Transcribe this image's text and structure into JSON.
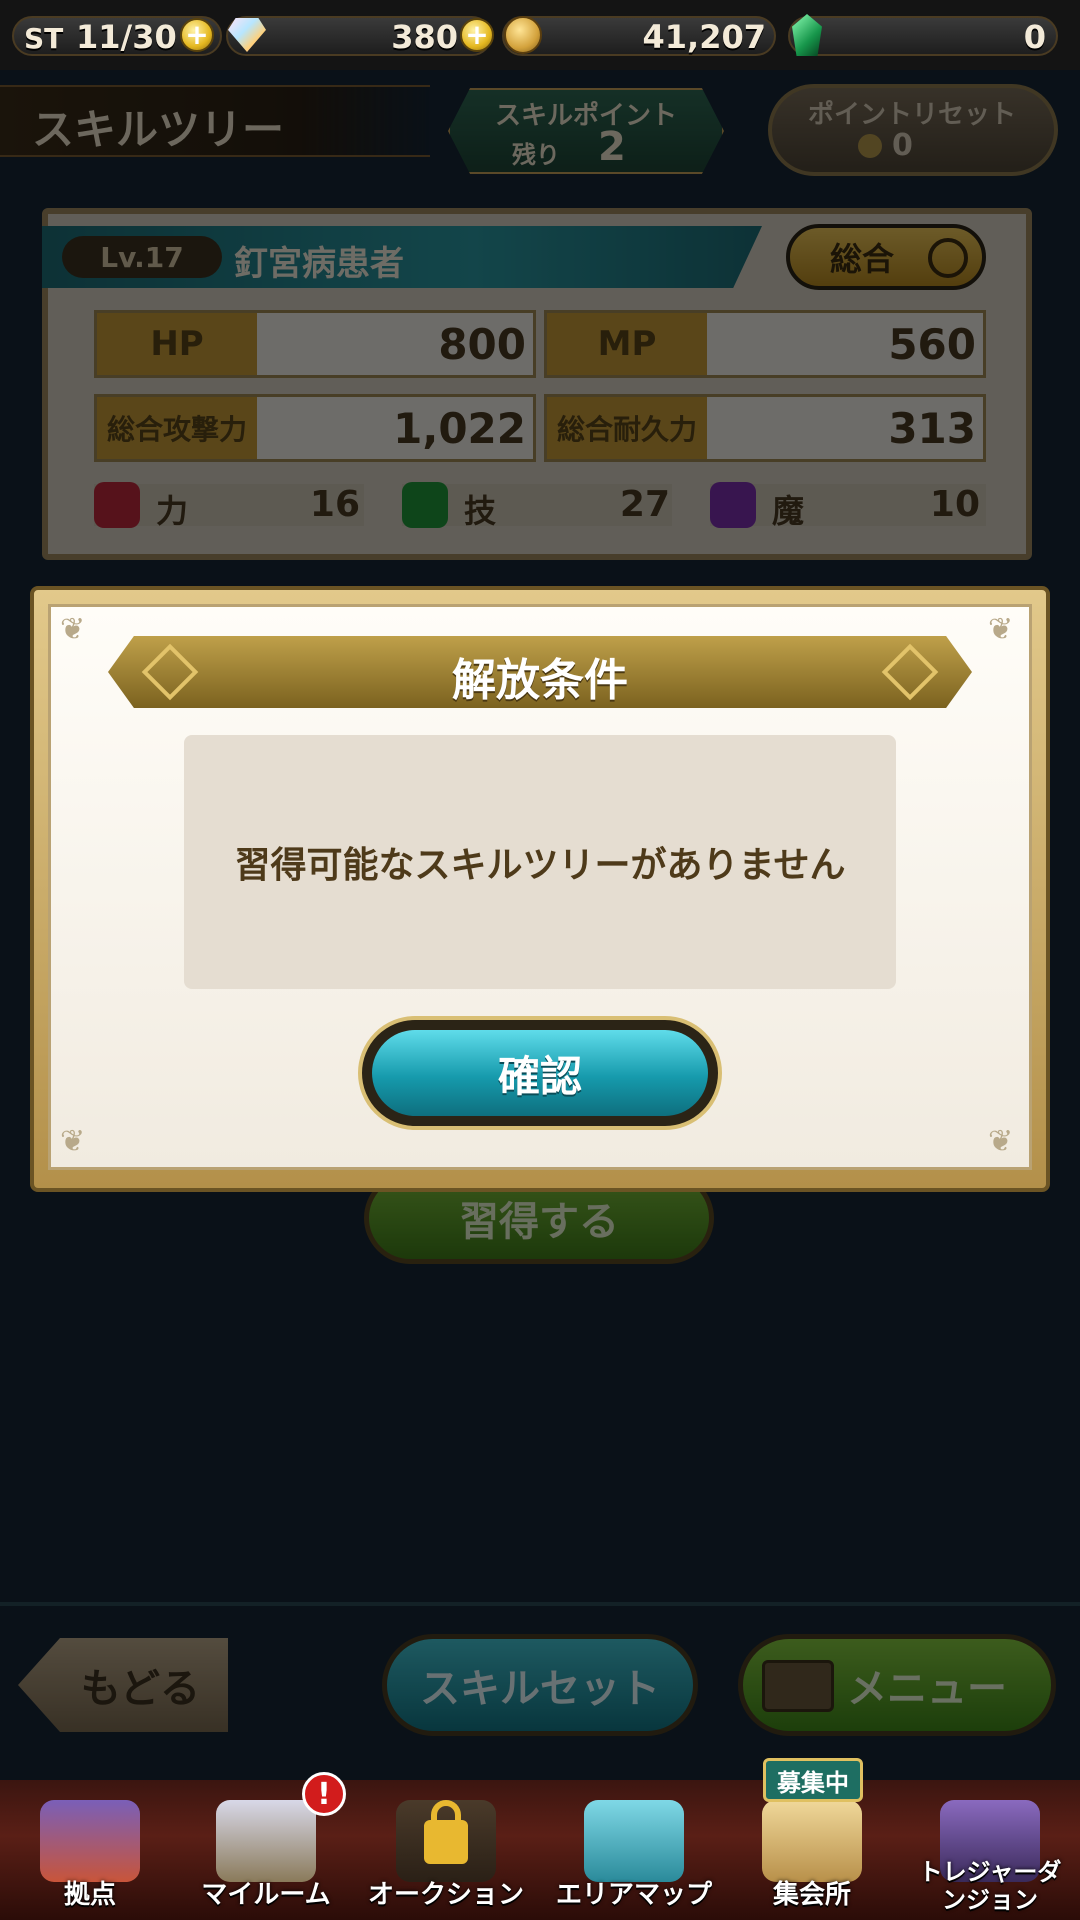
{
  "topbar": {
    "stamina_label": "ST",
    "stamina_value": "11/30",
    "gems_value": "380",
    "gold_value": "41,207",
    "green_gem_value": "0",
    "plus_symbol": "+"
  },
  "header": {
    "title": "スキルツリー",
    "skill_points_label": "スキルポイント",
    "skill_points_remaining_label": "残り",
    "skill_points_remaining_value": "2",
    "reset_label": "ポイントリセット",
    "reset_cost": "0"
  },
  "character": {
    "level": "Lv.17",
    "name": "釘宮病患者",
    "view_mode": "総合",
    "stats": [
      {
        "label": "HP",
        "value": "800"
      },
      {
        "label": "MP",
        "value": "560"
      },
      {
        "label": "総合攻撃力",
        "value": "1,022"
      },
      {
        "label": "総合耐久力",
        "value": "313"
      }
    ],
    "attributes": [
      {
        "label": "力",
        "value": "16",
        "icon": "fist-icon",
        "color": "#c0283c"
      },
      {
        "label": "技",
        "value": "27",
        "icon": "star-icon",
        "color": "#1f9a3a"
      },
      {
        "label": "魔",
        "value": "10",
        "icon": "magic-icon",
        "color": "#7c2fb0"
      }
    ]
  },
  "actions": {
    "learn_label": "習得する",
    "back_label": "もどる",
    "skillset_label": "スキルセット",
    "menu_label": "メニュー"
  },
  "modal": {
    "title": "解放条件",
    "message": "習得可能なスキルツリーがありません",
    "confirm_label": "確認"
  },
  "bottom_nav": {
    "items": [
      {
        "label": "拠点",
        "icon": "base-tent-icon"
      },
      {
        "label": "マイルーム",
        "icon": "sword-shield-icon"
      },
      {
        "label": "オークション",
        "icon": "locked-auction-icon"
      },
      {
        "label": "エリアマップ",
        "icon": "map-icon"
      },
      {
        "label": "集会所",
        "icon": "guild-hall-icon"
      },
      {
        "label": "トレジャーダンジョン",
        "icon": "treasure-dungeon-icon"
      }
    ],
    "alert_symbol": "!",
    "recruit_badge": "募集中"
  },
  "colors": {
    "accent_teal": "#169aac",
    "gold": "#c89b38",
    "green_button": "#3f7e18",
    "nav_background": "#5a1f16"
  }
}
